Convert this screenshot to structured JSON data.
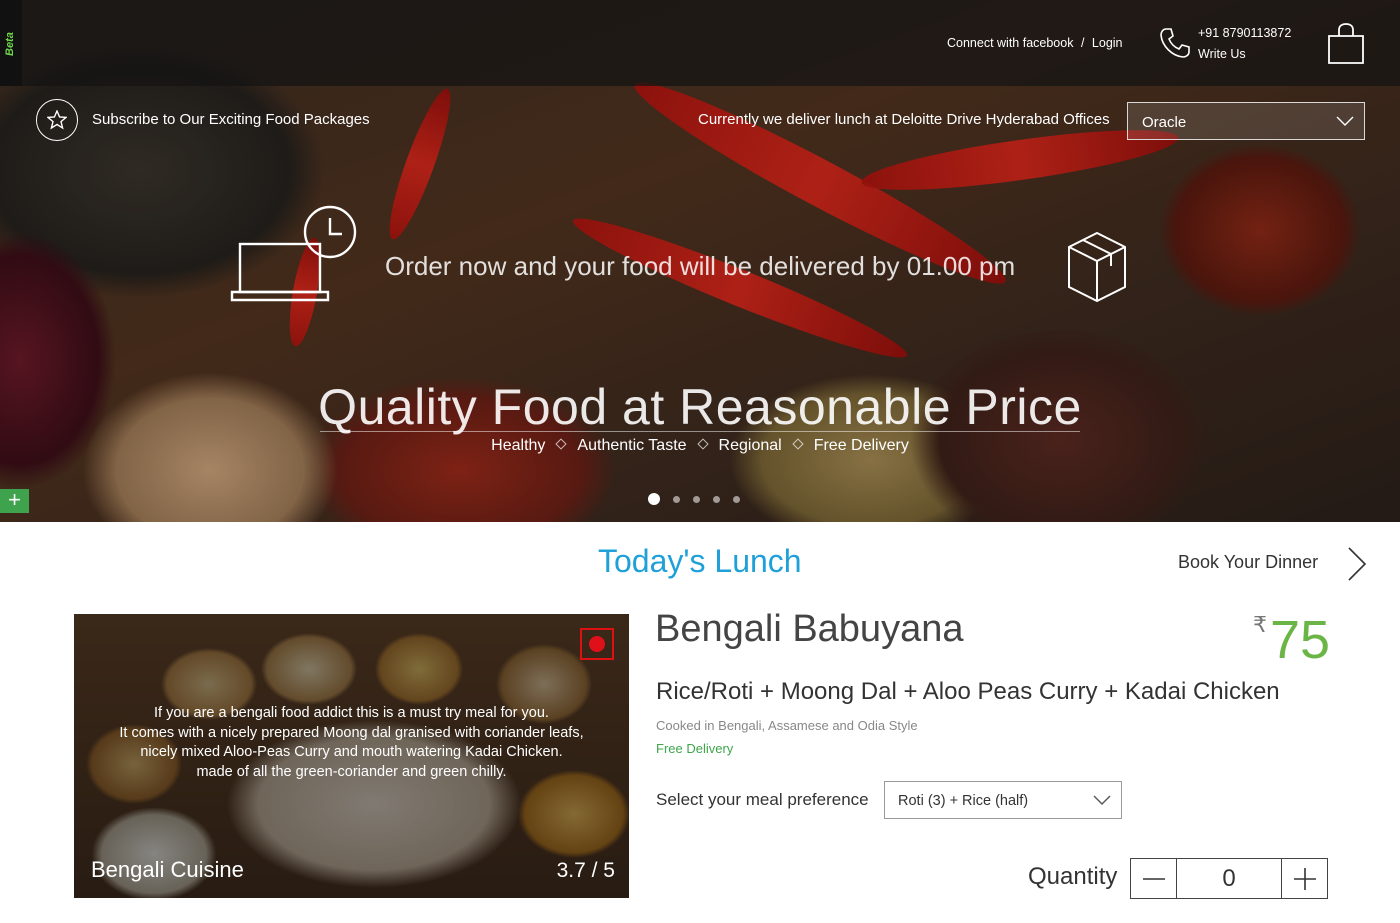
{
  "header": {
    "beta": "Beta",
    "connect_facebook": "Connect with facebook",
    "separator": "/",
    "login": "Login",
    "phone": "+91 8790113872",
    "write_us": "Write Us"
  },
  "hero": {
    "subscribe": "Subscribe to Our Exciting Food Packages",
    "delivery_notice": "Currently we deliver lunch at Deloitte Drive Hyderabad Offices",
    "office_selected": "Oracle",
    "order_message": "Order now and your food will be delivered by 01.00 pm",
    "tagline": "Quality Food at Reasonable Price",
    "features": [
      "Healthy",
      "Authentic Taste",
      "Regional",
      "Free Delivery"
    ],
    "slides_total": 5,
    "slide_active": 1,
    "plus": "+"
  },
  "section": {
    "title": "Today's Lunch",
    "book_dinner": "Book Your Dinner"
  },
  "meal": {
    "name": "Bengali Babuyana",
    "currency": "₹",
    "price": "75",
    "items": "Rice/Roti + Moong Dal + Aloo Peas Curry + Kadai Chicken",
    "cooked_style": "Cooked in Bengali, Assamese and Odia Style",
    "delivery": "Free Delivery",
    "description": [
      "If you are a bengali food addict this is a must try meal for you.",
      "It comes with a nicely prepared Moong dal granised with coriander leafs,",
      "nicely mixed Aloo-Peas Curry and mouth watering Kadai Chicken.",
      "made of all the green-coriander and green chilly."
    ],
    "cuisine": "Bengali Cuisine",
    "rating": "3.7 / 5",
    "preference_label": "Select your meal preference",
    "preference_selected": "Roti (3) + Rice (half)",
    "quantity_label": "Quantity",
    "quantity": "0"
  },
  "colors": {
    "accent_blue": "#1fa0d9",
    "price_green": "#6ab545",
    "delivery_green": "#3ea64a",
    "nonveg_red": "#e0101a"
  }
}
